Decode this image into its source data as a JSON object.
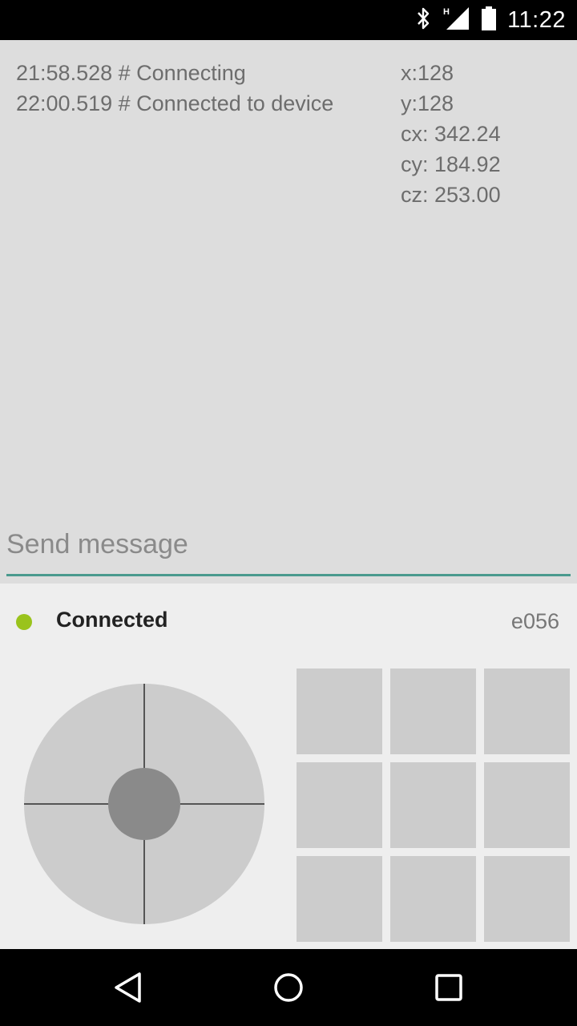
{
  "status_bar": {
    "time": "11:22",
    "icons": [
      "bluetooth-icon",
      "signal-h-icon",
      "battery-icon"
    ]
  },
  "log": {
    "lines": [
      "21:58.528 # Connecting",
      "22:00.519 # Connected to device"
    ]
  },
  "readouts": {
    "x": "x:128",
    "y": "y:128",
    "cx": "cx: 342.24",
    "cy": "cy: 184.92",
    "cz": "cz: 253.00"
  },
  "input": {
    "placeholder": "Send message",
    "value": ""
  },
  "connection": {
    "status": "Connected",
    "device_id": "e056",
    "status_color": "#9ac31c"
  },
  "accent_color": "#4a9a8e",
  "nav": {
    "icons": [
      "back-icon",
      "home-icon",
      "recents-icon"
    ]
  }
}
